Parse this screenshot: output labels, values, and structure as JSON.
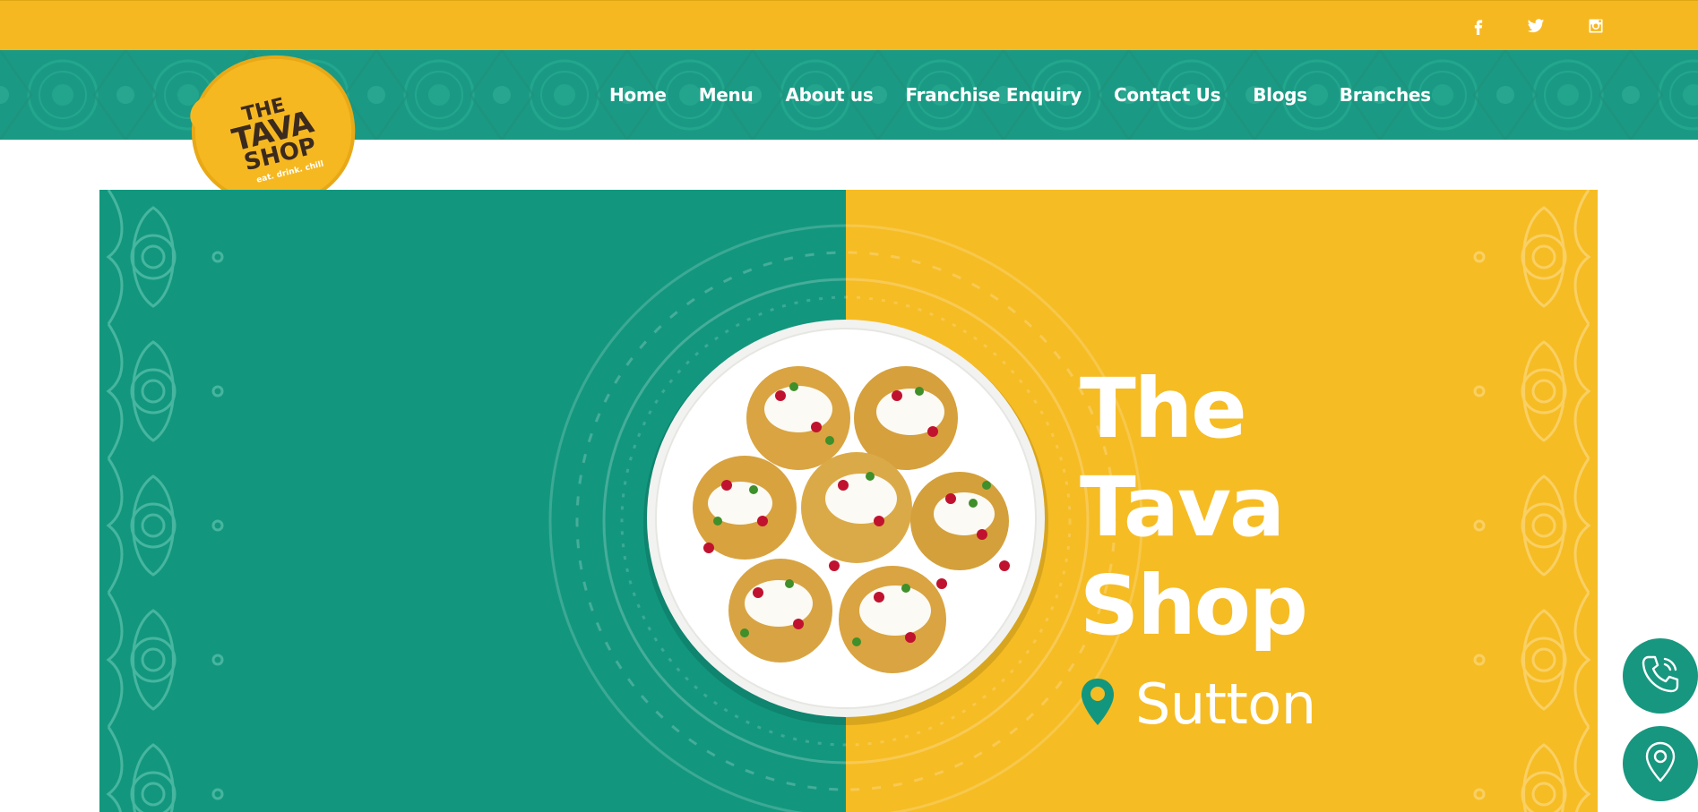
{
  "social": {
    "facebook": "facebook-icon",
    "twitter": "twitter-icon",
    "instagram": "instagram-icon"
  },
  "logo": {
    "line1": "THE",
    "line2": "TAVA",
    "line3": "SHOP",
    "tagline": "eat. drink. chill"
  },
  "nav": {
    "items": [
      {
        "label": "Home"
      },
      {
        "label": "Menu"
      },
      {
        "label": "About us"
      },
      {
        "label": "Franchise Enquiry"
      },
      {
        "label": "Contact Us"
      },
      {
        "label": "Blogs"
      },
      {
        "label": "Branches"
      }
    ]
  },
  "hero": {
    "title_lines": [
      "The",
      "Tava",
      "Shop"
    ],
    "location": "Sutton",
    "location_icon": "map-pin-icon"
  },
  "fabs": {
    "call": "phone-icon",
    "directions": "location-icon"
  },
  "colors": {
    "brand_yellow": "#f6b821",
    "brand_teal": "#12977e",
    "logo_text": "#3b2a1e"
  }
}
